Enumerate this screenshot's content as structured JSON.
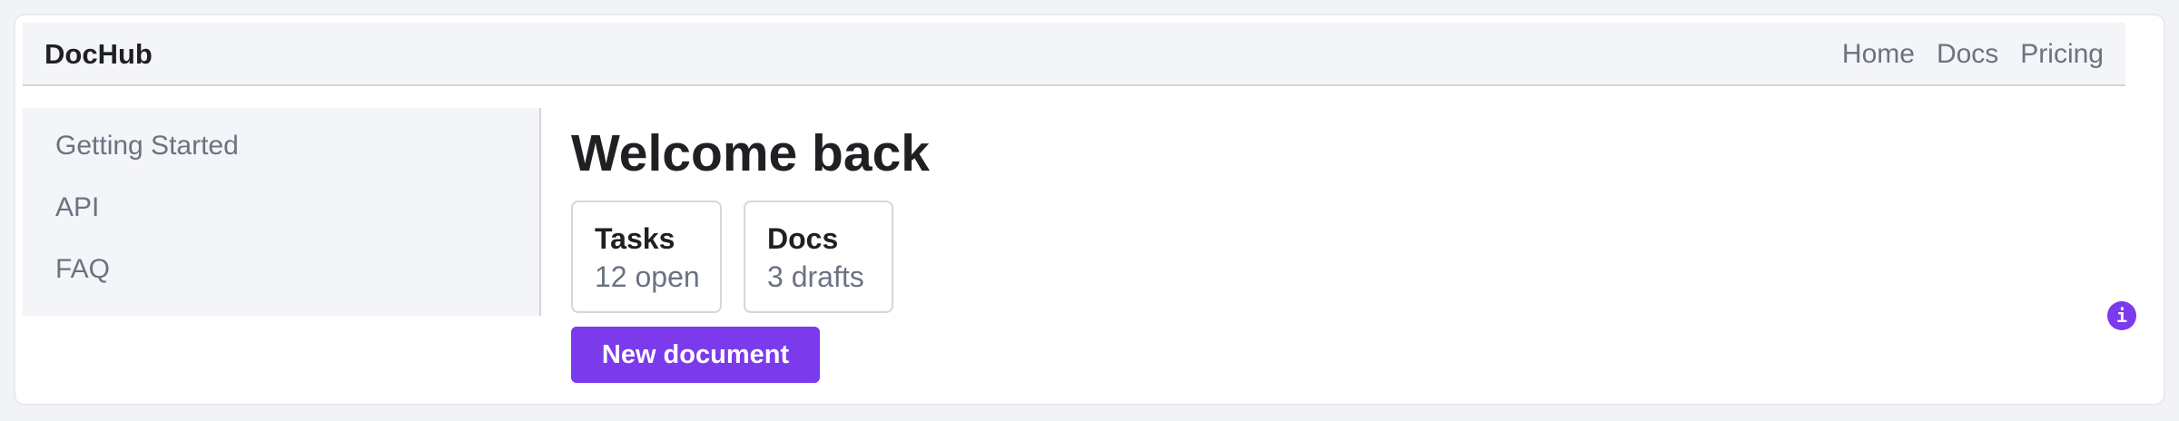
{
  "header": {
    "brand": "DocHub",
    "nav": [
      {
        "label": "Home"
      },
      {
        "label": "Docs"
      },
      {
        "label": "Pricing"
      }
    ]
  },
  "sidebar": {
    "items": [
      {
        "label": "Getting Started"
      },
      {
        "label": "API"
      },
      {
        "label": "FAQ"
      }
    ]
  },
  "main": {
    "title": "Welcome back",
    "cards": [
      {
        "title": "Tasks",
        "value": "12 open"
      },
      {
        "title": "Docs",
        "value": "3 drafts"
      }
    ],
    "primary_button": "New document"
  },
  "info_badge": {
    "glyph": "i",
    "icon": "info-icon"
  },
  "colors": {
    "accent": "#7c3aed",
    "background": "#f1f3f7",
    "panel": "#f4f5f8",
    "text": "#1f2023",
    "muted": "#6b7280"
  }
}
